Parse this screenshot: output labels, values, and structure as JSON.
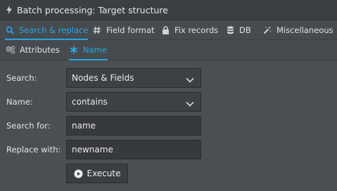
{
  "window": {
    "title": "Batch processing: Target structure",
    "title_icon": "bolt-icon"
  },
  "main_tabs": [
    {
      "label": "Search & replace",
      "icon": "search-icon",
      "active": true
    },
    {
      "label": "Field format",
      "icon": "hash-icon",
      "active": false
    },
    {
      "label": "Fix records",
      "icon": "lock-icon",
      "active": false
    },
    {
      "label": "DB",
      "icon": "database-icon",
      "active": false
    },
    {
      "label": "Miscellaneous",
      "icon": "magic-wand-icon",
      "active": false
    }
  ],
  "sub_tabs": [
    {
      "label": "Attributes",
      "icon": "gears-icon",
      "active": false
    },
    {
      "label": "Name",
      "icon": "asterisk-icon",
      "active": true
    }
  ],
  "form": {
    "search": {
      "label": "Search:",
      "value": "Nodes & Fields"
    },
    "name": {
      "label": "Name:",
      "value": "contains"
    },
    "search_for": {
      "label": "Search for:",
      "value": "name"
    },
    "replace_with": {
      "label": "Replace with:",
      "value": "newname"
    }
  },
  "execute_button": {
    "label": "Execute",
    "icon": "play-circle-icon"
  },
  "colors": {
    "accent": "#2aa4e0",
    "background": "#4a4f54",
    "field": "#36393d"
  }
}
